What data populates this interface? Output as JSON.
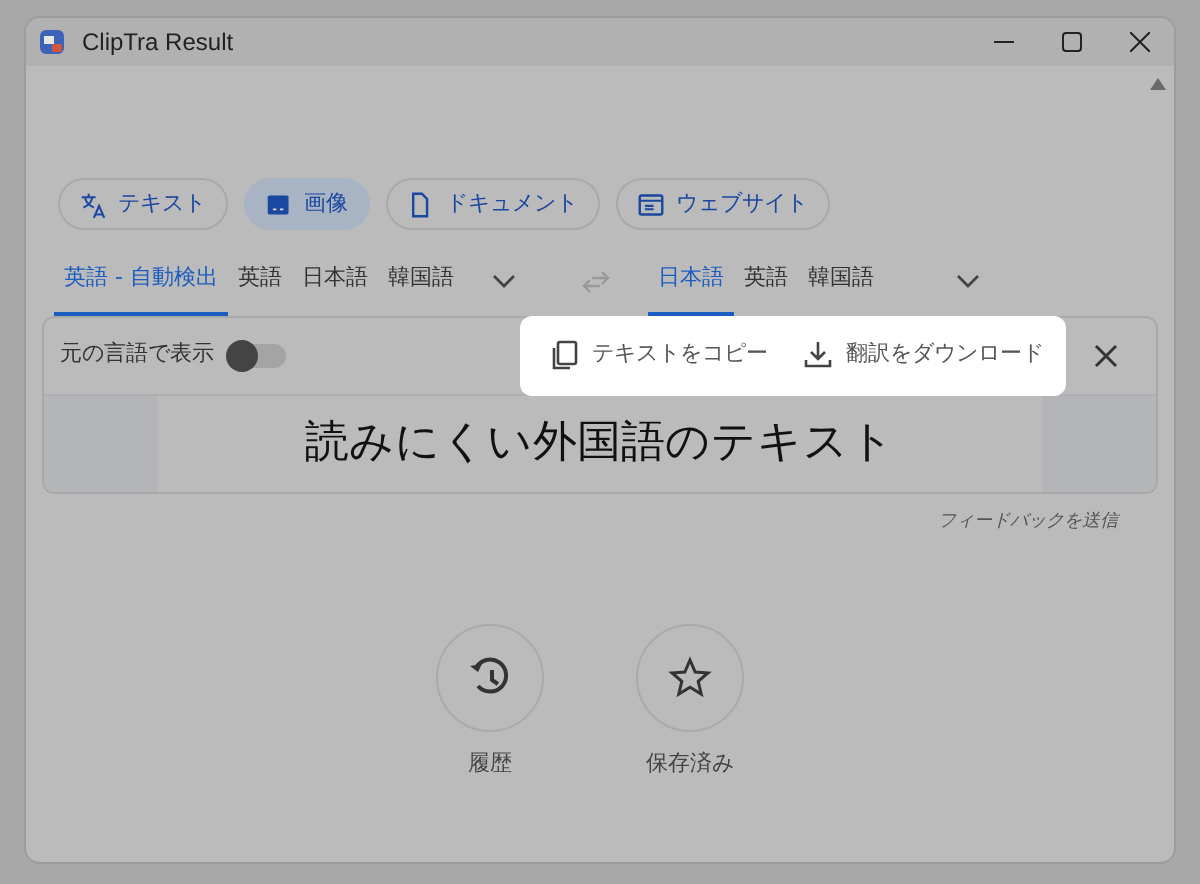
{
  "window": {
    "title": "ClipTra Result"
  },
  "modes": [
    {
      "label": "テキスト",
      "selected": false
    },
    {
      "label": "画像",
      "selected": true
    },
    {
      "label": "ドキュメント",
      "selected": false
    },
    {
      "label": "ウェブサイト",
      "selected": false
    }
  ],
  "source_languages": [
    {
      "label": "英語 - 自動検出",
      "selected": true
    },
    {
      "label": "英語",
      "selected": false
    },
    {
      "label": "日本語",
      "selected": false
    },
    {
      "label": "韓国語",
      "selected": false
    }
  ],
  "target_languages": [
    {
      "label": "日本語",
      "selected": true
    },
    {
      "label": "英語",
      "selected": false
    },
    {
      "label": "韓国語",
      "selected": false
    }
  ],
  "show_original": {
    "label": "元の言語で表示",
    "on": false
  },
  "actions": [
    {
      "label": "テキストをコピー"
    },
    {
      "label": "翻訳をダウンロード"
    }
  ],
  "result_text": "読みにくい外国語のテキスト",
  "feedback": "フィードバックを送信",
  "bottom_buttons": [
    {
      "label": "履歴"
    },
    {
      "label": "保存済み"
    }
  ]
}
